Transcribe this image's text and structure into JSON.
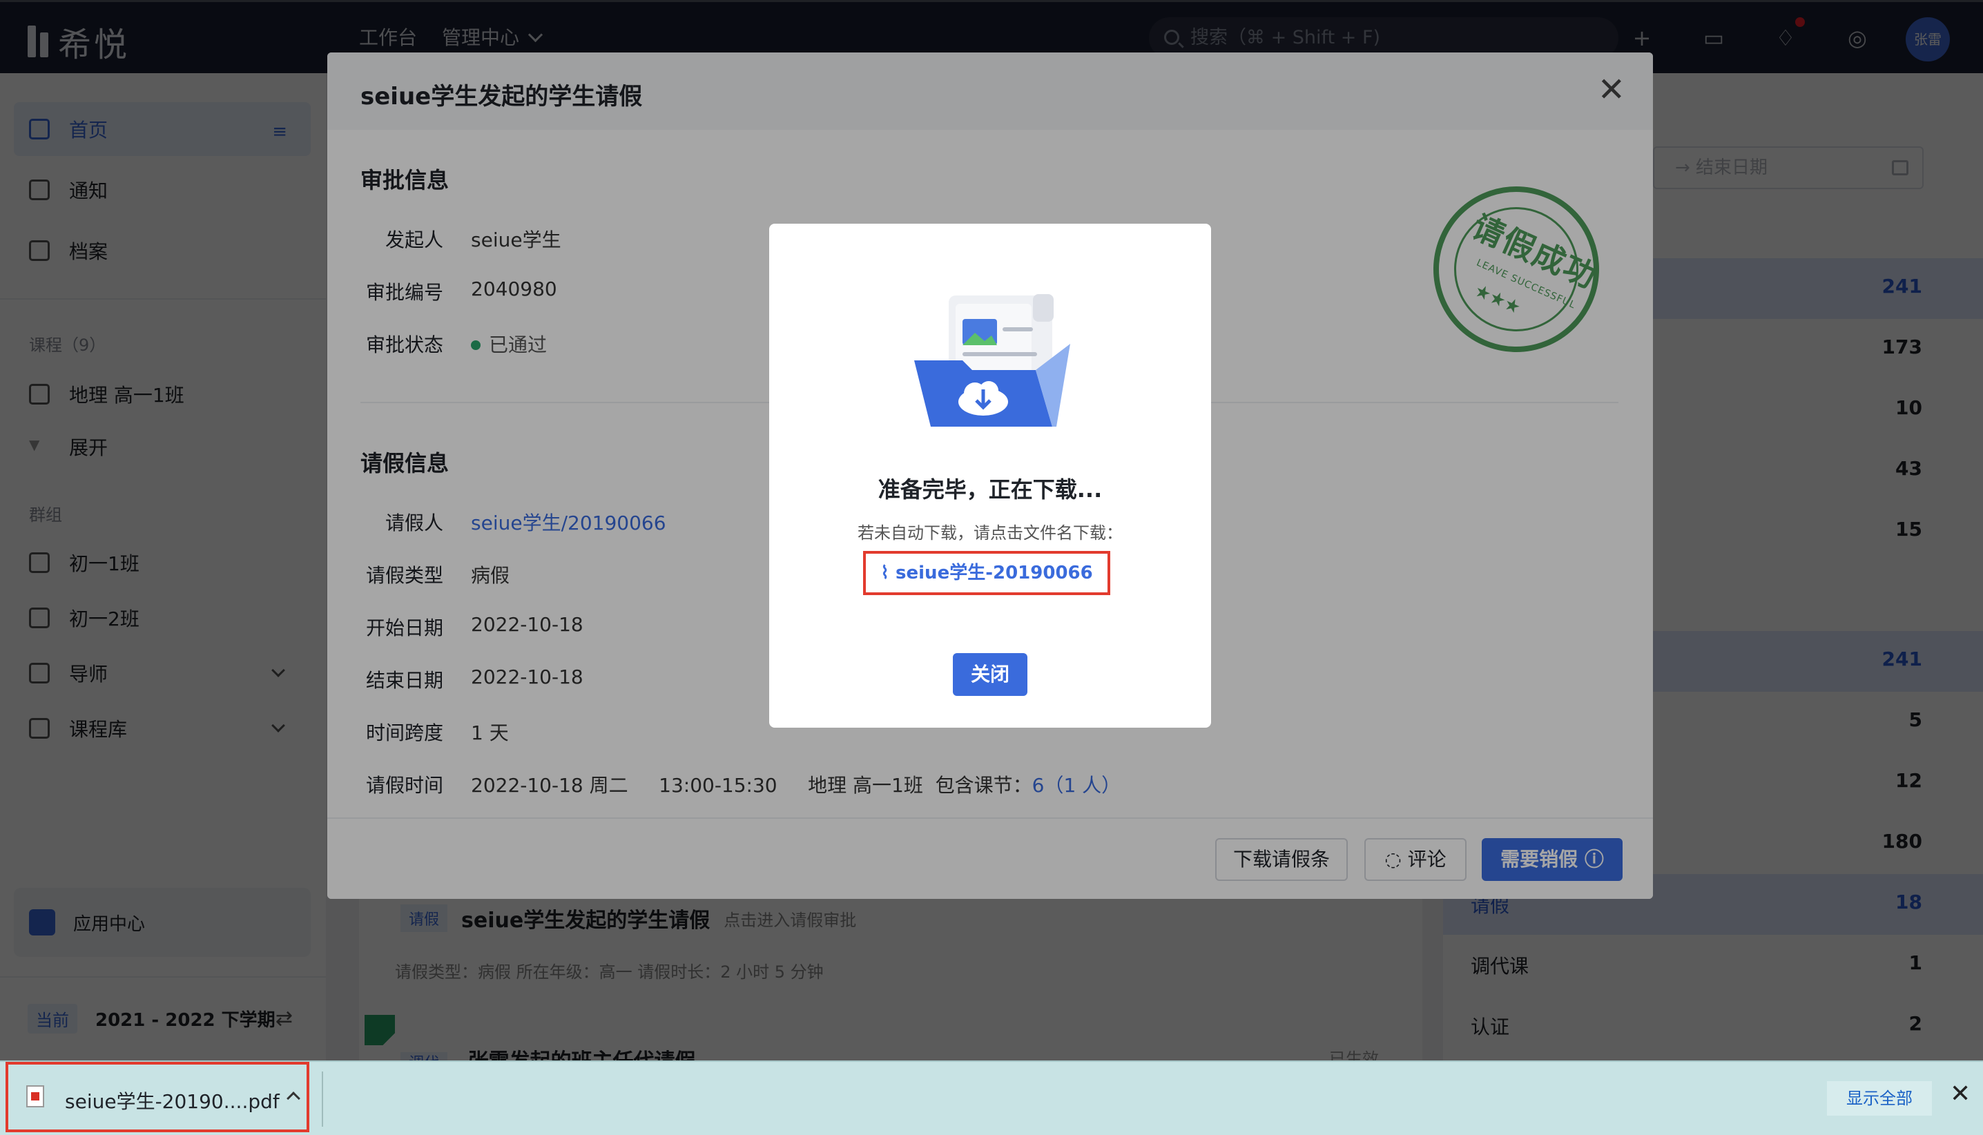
{
  "topbar": {
    "logo_text": "希悦",
    "nav": [
      "工作台",
      "管理中心"
    ],
    "search_placeholder": "搜索（⌘ + Shift + F)",
    "avatar_text": "张雷"
  },
  "sidebar": {
    "home": "首页",
    "notice": "通知",
    "archive": "档案",
    "course_group_label": "课程（9）",
    "course_item": "地理 高一1班",
    "expand": "展开",
    "group_label": "群组",
    "group_items": [
      "初一1班",
      "初一2班"
    ],
    "tutor": "导师",
    "course_lib": "课程库",
    "app_center": "应用中心",
    "term_tag": "当前",
    "term": "2021 - 2022 下学期"
  },
  "background": {
    "end_date_placeholder": "→  结束日期",
    "stats": [
      {
        "label": "",
        "value": "241"
      },
      {
        "label": "",
        "value": "173"
      },
      {
        "label": "",
        "value": "10"
      },
      {
        "label": "",
        "value": "43"
      },
      {
        "label": "",
        "value": "15"
      },
      {
        "label": "",
        "value": "241"
      },
      {
        "label": "",
        "value": "5"
      },
      {
        "label": "",
        "value": "12"
      },
      {
        "label": "",
        "value": "180"
      },
      {
        "label": "请假",
        "value": "18"
      },
      {
        "label": "调代课",
        "value": "1"
      },
      {
        "label": "认证",
        "value": "2"
      }
    ],
    "card1_badge": "请假",
    "card1_title": "seiue学生发起的学生请假",
    "card1_hint": "点击进入请假审批",
    "card1_meta": "请假类型：病假    所在年级：高一    请假时长：2 小时 5 分钟",
    "card2_badge": "调代",
    "card2_title": "张雷发起的班主任代请假",
    "card2_right": "已生效"
  },
  "modal": {
    "title": "seiue学生发起的学生请假",
    "approval_section": "审批信息",
    "approval": [
      {
        "k": "发起人",
        "v": "seiue学生"
      },
      {
        "k": "审批编号",
        "v": "2040980"
      },
      {
        "k": "审批状态",
        "v": "已通过"
      }
    ],
    "leave_section": "请假信息",
    "leave": [
      {
        "k": "请假人",
        "v": "seiue学生/20190066"
      },
      {
        "k": "请假类型",
        "v": "病假"
      },
      {
        "k": "开始日期",
        "v": "2022-10-18"
      },
      {
        "k": "结束日期",
        "v": "2022-10-18"
      },
      {
        "k": "时间跨度",
        "v": "1 天"
      },
      {
        "k": "请假时间",
        "v": "2022-10-18 周二     13:00-15:30     地理 高一1班  包含课节："
      }
    ],
    "lesson_count": "6（1 人）",
    "stamp_text": "请假成功",
    "stamp_sub": "LEAVE SUCCESSFUL",
    "buttons": {
      "download": "下载请假条",
      "comment": "评论",
      "cancel_leave": "需要销假"
    }
  },
  "download_dialog": {
    "title": "准备完毕，正在下载...",
    "subtitle": "若未自动下载，请点击文件名下载：",
    "file_link": "seiue学生-20190066",
    "close": "关闭"
  },
  "download_shelf": {
    "file": "seiue学生-20190....pdf",
    "show_all": "显示全部"
  },
  "colors": {
    "accent": "#3a6bdc",
    "success": "#29a46a",
    "highlight_border": "#e23b2e"
  }
}
